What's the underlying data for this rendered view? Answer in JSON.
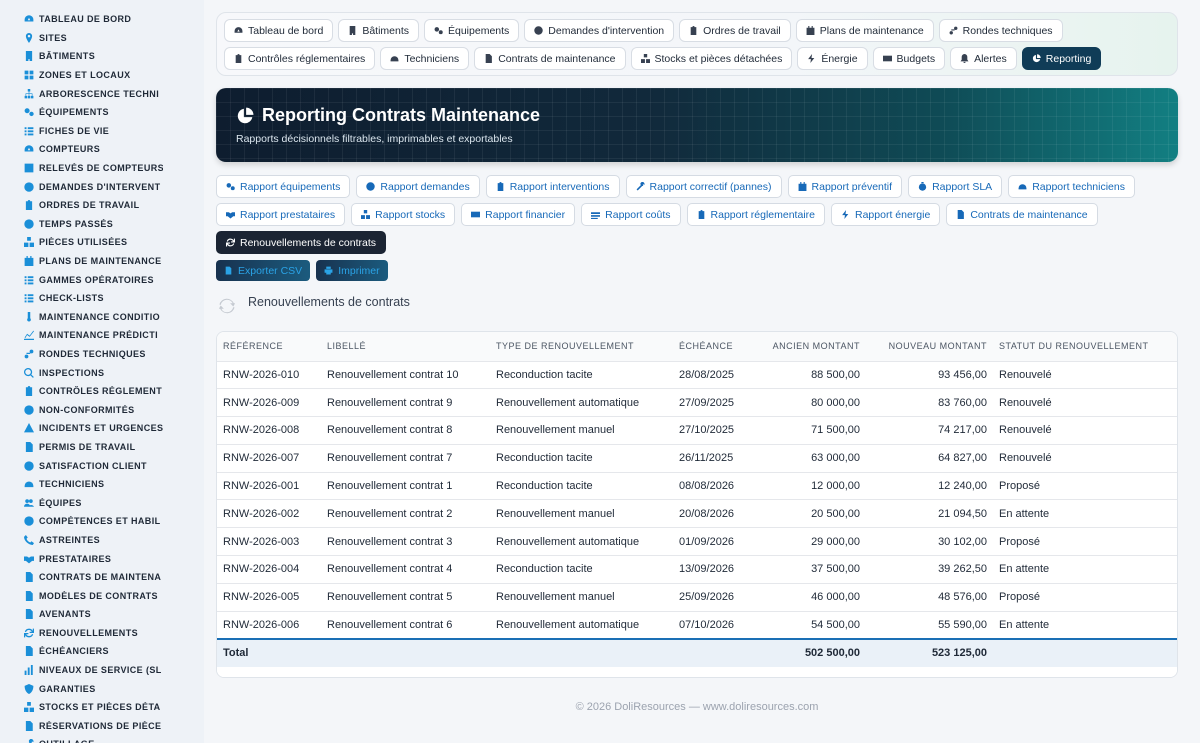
{
  "sidebar": {
    "items": [
      {
        "label": "TABLEAU DE BORD",
        "icon": "gauge-icon"
      },
      {
        "label": "SITES",
        "icon": "map-pin-icon"
      },
      {
        "label": "BÂTIMENTS",
        "icon": "building-icon"
      },
      {
        "label": "ZONES ET LOCAUX",
        "icon": "grid-icon"
      },
      {
        "label": "ARBORESCENCE TECHNI",
        "icon": "sitemap-icon"
      },
      {
        "label": "ÉQUIPEMENTS",
        "icon": "gears-icon"
      },
      {
        "label": "FICHES DE VIE",
        "icon": "list-icon"
      },
      {
        "label": "COMPTEURS",
        "icon": "gauge-icon"
      },
      {
        "label": "RELEVÉS DE COMPTEURS",
        "icon": "pen-square-icon"
      },
      {
        "label": "DEMANDES D'INTERVENT",
        "icon": "question-circle-icon"
      },
      {
        "label": "ORDRES DE TRAVAIL",
        "icon": "clipboard-icon"
      },
      {
        "label": "TEMPS PASSÉS",
        "icon": "clock-icon"
      },
      {
        "label": "PIÈCES UTILISÉES",
        "icon": "boxes-icon"
      },
      {
        "label": "PLANS DE MAINTENANCE",
        "icon": "calendar-icon"
      },
      {
        "label": "GAMMES OPÉRATOIRES",
        "icon": "list-ol-icon"
      },
      {
        "label": "CHECK-LISTS",
        "icon": "check-list-icon"
      },
      {
        "label": "MAINTENANCE CONDITIO",
        "icon": "thermometer-icon"
      },
      {
        "label": "MAINTENANCE PRÉDICTI",
        "icon": "chart-line-icon"
      },
      {
        "label": "RONDES TECHNIQUES",
        "icon": "route-icon"
      },
      {
        "label": "INSPECTIONS",
        "icon": "search-icon"
      },
      {
        "label": "CONTRÔLES RÉGLEMENT",
        "icon": "clipboard-check-icon"
      },
      {
        "label": "NON-CONFORMITÉS",
        "icon": "exclamation-circle-icon"
      },
      {
        "label": "INCIDENTS ET URGENCES",
        "icon": "warning-triangle-icon"
      },
      {
        "label": "PERMIS DE TRAVAIL",
        "icon": "file-icon"
      },
      {
        "label": "SATISFACTION CLIENT",
        "icon": "smile-icon"
      },
      {
        "label": "TECHNICIENS",
        "icon": "hard-hat-icon"
      },
      {
        "label": "ÉQUIPES",
        "icon": "users-icon"
      },
      {
        "label": "COMPÉTENCES ET HABIL",
        "icon": "certificate-icon"
      },
      {
        "label": "ASTREINTES",
        "icon": "phone-icon"
      },
      {
        "label": "PRESTATAIRES",
        "icon": "handshake-icon"
      },
      {
        "label": "CONTRATS DE MAINTENA",
        "icon": "file-contract-icon"
      },
      {
        "label": "MODÈLES DE CONTRATS",
        "icon": "file-alt-icon"
      },
      {
        "label": "AVENANTS",
        "icon": "file-signature-icon"
      },
      {
        "label": "RENOUVELLEMENTS",
        "icon": "sync-icon"
      },
      {
        "label": "ÉCHÉANCIERS",
        "icon": "file-invoice-icon"
      },
      {
        "label": "NIVEAUX DE SERVICE (SL",
        "icon": "chart-bar-icon"
      },
      {
        "label": "GARANTIES",
        "icon": "shield-icon"
      },
      {
        "label": "STOCKS ET PIÈCES DÉTA",
        "icon": "boxes-icon"
      },
      {
        "label": "RÉSERVATIONS DE PIÈCE",
        "icon": "file-icon"
      },
      {
        "label": "OUTILLAGE",
        "icon": "tools-icon"
      }
    ]
  },
  "nav": {
    "row1": [
      {
        "label": "Tableau de bord",
        "icon": "gauge-icon"
      },
      {
        "label": "Bâtiments",
        "icon": "building-icon"
      },
      {
        "label": "Équipements",
        "icon": "gears-icon"
      },
      {
        "label": "Demandes d'intervention",
        "icon": "question-circle-icon"
      },
      {
        "label": "Ordres de travail",
        "icon": "clipboard-icon"
      },
      {
        "label": "Plans de maintenance",
        "icon": "calendar-icon"
      },
      {
        "label": "Rondes techniques",
        "icon": "route-icon"
      }
    ],
    "row2": [
      {
        "label": "Contrôles réglementaires",
        "icon": "clipboard-check-icon"
      },
      {
        "label": "Techniciens",
        "icon": "hard-hat-icon"
      },
      {
        "label": "Contrats de maintenance",
        "icon": "file-contract-icon"
      },
      {
        "label": "Stocks et pièces détachées",
        "icon": "boxes-icon"
      },
      {
        "label": "Énergie",
        "icon": "bolt-icon"
      },
      {
        "label": "Budgets",
        "icon": "money-icon"
      },
      {
        "label": "Alertes",
        "icon": "bell-icon"
      },
      {
        "label": "Reporting",
        "icon": "chart-pie-icon",
        "active": true
      }
    ]
  },
  "banner": {
    "title": "Reporting Contrats Maintenance",
    "subtitle": "Rapports décisionnels filtrables, imprimables et exportables"
  },
  "reports": {
    "row1": [
      {
        "label": "Rapport équipements",
        "icon": "gears-icon"
      },
      {
        "label": "Rapport demandes",
        "icon": "question-circle-icon"
      },
      {
        "label": "Rapport interventions",
        "icon": "clipboard-icon"
      },
      {
        "label": "Rapport correctif (pannes)",
        "icon": "tools-icon"
      },
      {
        "label": "Rapport préventif",
        "icon": "calendar-icon"
      },
      {
        "label": "Rapport SLA",
        "icon": "stopwatch-icon"
      },
      {
        "label": "Rapport techniciens",
        "icon": "hard-hat-icon"
      }
    ],
    "row2": [
      {
        "label": "Rapport prestataires",
        "icon": "handshake-icon"
      },
      {
        "label": "Rapport stocks",
        "icon": "boxes-icon"
      },
      {
        "label": "Rapport financier",
        "icon": "money-icon"
      },
      {
        "label": "Rapport coûts",
        "icon": "coins-icon"
      },
      {
        "label": "Rapport réglementaire",
        "icon": "clipboard-check-icon"
      },
      {
        "label": "Rapport énergie",
        "icon": "bolt-icon"
      },
      {
        "label": "Contrats de maintenance",
        "icon": "file-contract-icon"
      }
    ],
    "row3": [
      {
        "label": "Renouvellements de contrats",
        "icon": "sync-icon",
        "active": true
      }
    ]
  },
  "actions": {
    "export_label": "Exporter CSV",
    "print_label": "Imprimer"
  },
  "section": {
    "title": "Renouvellements de contrats"
  },
  "table": {
    "columns": [
      "RÉFÉRENCE",
      "LIBELLÉ",
      "TYPE DE RENOUVELLEMENT",
      "ÉCHÉANCE",
      "ANCIEN MONTANT",
      "NOUVEAU MONTANT",
      "STATUT DU RENOUVELLEMENT"
    ],
    "rows": [
      [
        "RNW-2026-010",
        "Renouvellement contrat 10",
        "Reconduction tacite",
        "28/08/2025",
        "88 500,00",
        "93 456,00",
        "Renouvelé"
      ],
      [
        "RNW-2026-009",
        "Renouvellement contrat 9",
        "Renouvellement automatique",
        "27/09/2025",
        "80 000,00",
        "83 760,00",
        "Renouvelé"
      ],
      [
        "RNW-2026-008",
        "Renouvellement contrat 8",
        "Renouvellement manuel",
        "27/10/2025",
        "71 500,00",
        "74 217,00",
        "Renouvelé"
      ],
      [
        "RNW-2026-007",
        "Renouvellement contrat 7",
        "Reconduction tacite",
        "26/11/2025",
        "63 000,00",
        "64 827,00",
        "Renouvelé"
      ],
      [
        "RNW-2026-001",
        "Renouvellement contrat 1",
        "Reconduction tacite",
        "08/08/2026",
        "12 000,00",
        "12 240,00",
        "Proposé"
      ],
      [
        "RNW-2026-002",
        "Renouvellement contrat 2",
        "Renouvellement manuel",
        "20/08/2026",
        "20 500,00",
        "21 094,50",
        "En attente"
      ],
      [
        "RNW-2026-003",
        "Renouvellement contrat 3",
        "Renouvellement automatique",
        "01/09/2026",
        "29 000,00",
        "30 102,00",
        "Proposé"
      ],
      [
        "RNW-2026-004",
        "Renouvellement contrat 4",
        "Reconduction tacite",
        "13/09/2026",
        "37 500,00",
        "39 262,50",
        "En attente"
      ],
      [
        "RNW-2026-005",
        "Renouvellement contrat 5",
        "Renouvellement manuel",
        "25/09/2026",
        "46 000,00",
        "48 576,00",
        "Proposé"
      ],
      [
        "RNW-2026-006",
        "Renouvellement contrat 6",
        "Renouvellement automatique",
        "07/10/2026",
        "54 500,00",
        "55 590,00",
        "En attente"
      ]
    ],
    "total": {
      "label": "Total",
      "old_amount": "502 500,00",
      "new_amount": "523 125,00"
    }
  },
  "footer": {
    "text": "© 2026 DoliResources — www.doliresources.com"
  },
  "colors": {
    "accent": "#1769b8",
    "nav_active": "#103c57",
    "report_active": "#1b2433",
    "sidebar_icon": "#1a8fd8"
  }
}
